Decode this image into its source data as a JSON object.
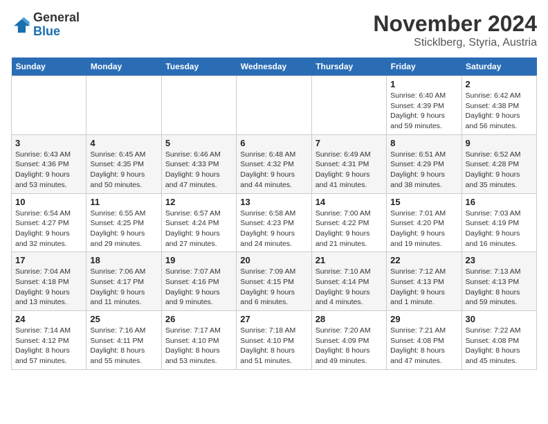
{
  "header": {
    "logo_general": "General",
    "logo_blue": "Blue",
    "title": "November 2024",
    "subtitle": "Sticklberg, Styria, Austria"
  },
  "weekdays": [
    "Sunday",
    "Monday",
    "Tuesday",
    "Wednesday",
    "Thursday",
    "Friday",
    "Saturday"
  ],
  "weeks": [
    [
      {
        "day": "",
        "info": ""
      },
      {
        "day": "",
        "info": ""
      },
      {
        "day": "",
        "info": ""
      },
      {
        "day": "",
        "info": ""
      },
      {
        "day": "",
        "info": ""
      },
      {
        "day": "1",
        "info": "Sunrise: 6:40 AM\nSunset: 4:39 PM\nDaylight: 9 hours\nand 59 minutes."
      },
      {
        "day": "2",
        "info": "Sunrise: 6:42 AM\nSunset: 4:38 PM\nDaylight: 9 hours\nand 56 minutes."
      }
    ],
    [
      {
        "day": "3",
        "info": "Sunrise: 6:43 AM\nSunset: 4:36 PM\nDaylight: 9 hours\nand 53 minutes."
      },
      {
        "day": "4",
        "info": "Sunrise: 6:45 AM\nSunset: 4:35 PM\nDaylight: 9 hours\nand 50 minutes."
      },
      {
        "day": "5",
        "info": "Sunrise: 6:46 AM\nSunset: 4:33 PM\nDaylight: 9 hours\nand 47 minutes."
      },
      {
        "day": "6",
        "info": "Sunrise: 6:48 AM\nSunset: 4:32 PM\nDaylight: 9 hours\nand 44 minutes."
      },
      {
        "day": "7",
        "info": "Sunrise: 6:49 AM\nSunset: 4:31 PM\nDaylight: 9 hours\nand 41 minutes."
      },
      {
        "day": "8",
        "info": "Sunrise: 6:51 AM\nSunset: 4:29 PM\nDaylight: 9 hours\nand 38 minutes."
      },
      {
        "day": "9",
        "info": "Sunrise: 6:52 AM\nSunset: 4:28 PM\nDaylight: 9 hours\nand 35 minutes."
      }
    ],
    [
      {
        "day": "10",
        "info": "Sunrise: 6:54 AM\nSunset: 4:27 PM\nDaylight: 9 hours\nand 32 minutes."
      },
      {
        "day": "11",
        "info": "Sunrise: 6:55 AM\nSunset: 4:25 PM\nDaylight: 9 hours\nand 29 minutes."
      },
      {
        "day": "12",
        "info": "Sunrise: 6:57 AM\nSunset: 4:24 PM\nDaylight: 9 hours\nand 27 minutes."
      },
      {
        "day": "13",
        "info": "Sunrise: 6:58 AM\nSunset: 4:23 PM\nDaylight: 9 hours\nand 24 minutes."
      },
      {
        "day": "14",
        "info": "Sunrise: 7:00 AM\nSunset: 4:22 PM\nDaylight: 9 hours\nand 21 minutes."
      },
      {
        "day": "15",
        "info": "Sunrise: 7:01 AM\nSunset: 4:20 PM\nDaylight: 9 hours\nand 19 minutes."
      },
      {
        "day": "16",
        "info": "Sunrise: 7:03 AM\nSunset: 4:19 PM\nDaylight: 9 hours\nand 16 minutes."
      }
    ],
    [
      {
        "day": "17",
        "info": "Sunrise: 7:04 AM\nSunset: 4:18 PM\nDaylight: 9 hours\nand 13 minutes."
      },
      {
        "day": "18",
        "info": "Sunrise: 7:06 AM\nSunset: 4:17 PM\nDaylight: 9 hours\nand 11 minutes."
      },
      {
        "day": "19",
        "info": "Sunrise: 7:07 AM\nSunset: 4:16 PM\nDaylight: 9 hours\nand 9 minutes."
      },
      {
        "day": "20",
        "info": "Sunrise: 7:09 AM\nSunset: 4:15 PM\nDaylight: 9 hours\nand 6 minutes."
      },
      {
        "day": "21",
        "info": "Sunrise: 7:10 AM\nSunset: 4:14 PM\nDaylight: 9 hours\nand 4 minutes."
      },
      {
        "day": "22",
        "info": "Sunrise: 7:12 AM\nSunset: 4:13 PM\nDaylight: 9 hours\nand 1 minute."
      },
      {
        "day": "23",
        "info": "Sunrise: 7:13 AM\nSunset: 4:13 PM\nDaylight: 8 hours\nand 59 minutes."
      }
    ],
    [
      {
        "day": "24",
        "info": "Sunrise: 7:14 AM\nSunset: 4:12 PM\nDaylight: 8 hours\nand 57 minutes."
      },
      {
        "day": "25",
        "info": "Sunrise: 7:16 AM\nSunset: 4:11 PM\nDaylight: 8 hours\nand 55 minutes."
      },
      {
        "day": "26",
        "info": "Sunrise: 7:17 AM\nSunset: 4:10 PM\nDaylight: 8 hours\nand 53 minutes."
      },
      {
        "day": "27",
        "info": "Sunrise: 7:18 AM\nSunset: 4:10 PM\nDaylight: 8 hours\nand 51 minutes."
      },
      {
        "day": "28",
        "info": "Sunrise: 7:20 AM\nSunset: 4:09 PM\nDaylight: 8 hours\nand 49 minutes."
      },
      {
        "day": "29",
        "info": "Sunrise: 7:21 AM\nSunset: 4:08 PM\nDaylight: 8 hours\nand 47 minutes."
      },
      {
        "day": "30",
        "info": "Sunrise: 7:22 AM\nSunset: 4:08 PM\nDaylight: 8 hours\nand 45 minutes."
      }
    ]
  ]
}
